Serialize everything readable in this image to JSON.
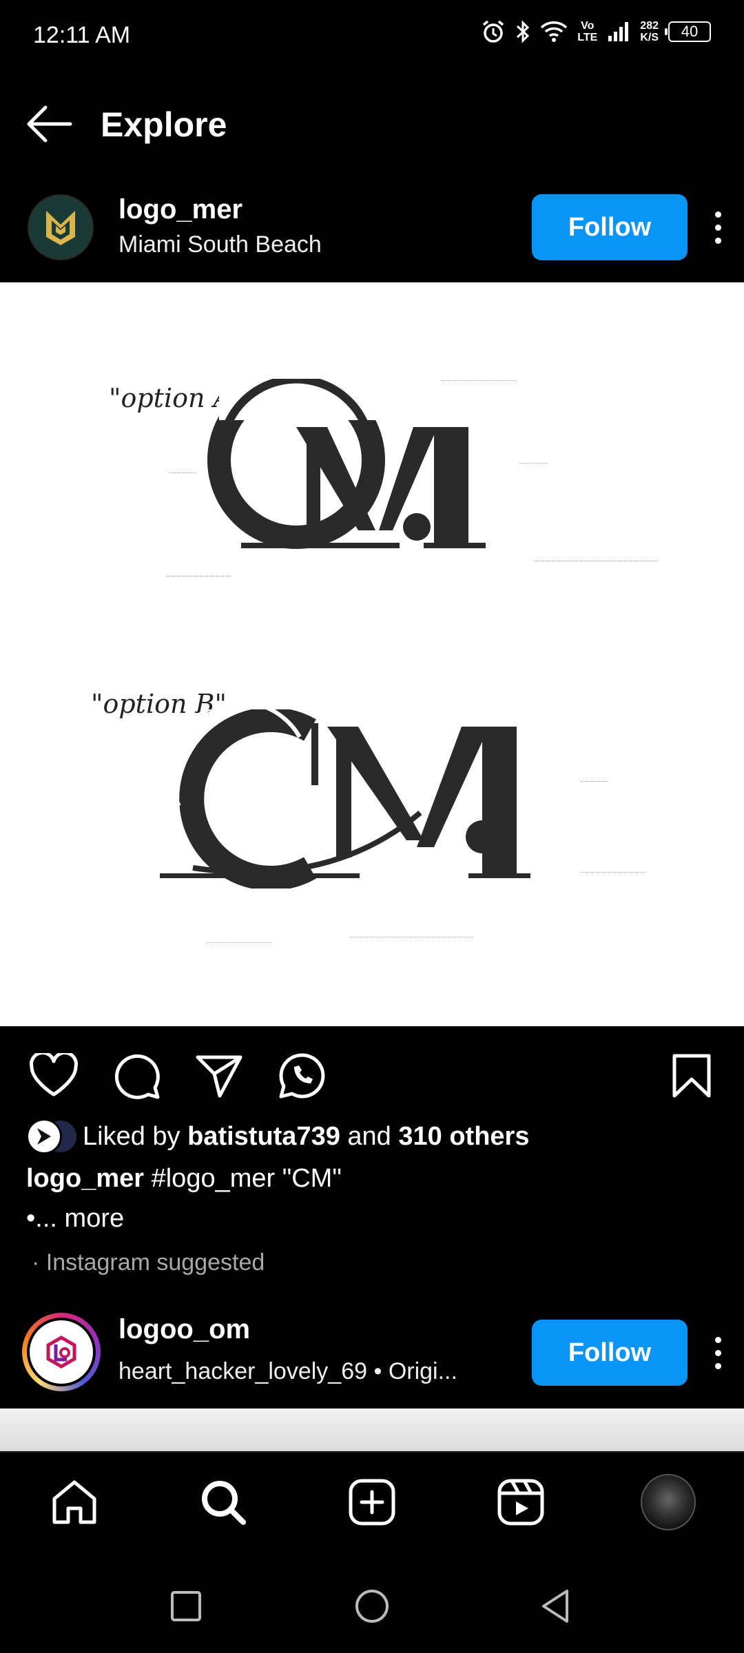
{
  "status_bar": {
    "time": "12:11 AM",
    "net_top": "Vo",
    "net_bottom": "LTE",
    "speed_value": "282",
    "speed_unit": "K/S",
    "battery": "40"
  },
  "header": {
    "title": "Explore"
  },
  "post": {
    "username": "logo_mer",
    "location": "Miami South Beach",
    "follow_label": "Follow",
    "image": {
      "option_a_label": "\"option A\"",
      "option_b_label": "\"option B\"",
      "monogram_letters": "CM"
    },
    "likes": {
      "prefix": "Liked by ",
      "liker": "batistuta739",
      "middle": " and ",
      "others": "310 others"
    },
    "caption": {
      "username": "logo_mer",
      "hashtag": "#logo_mer",
      "text": " \"CM\"",
      "more": "•... more"
    },
    "suggested_label": "· Instagram suggested"
  },
  "next_post": {
    "username": "logoo_om",
    "subtitle": "heart_hacker_lovely_69  •  Origi...",
    "follow_label": "Follow"
  },
  "icons": {
    "back": "arrow-left-icon",
    "like": "heart-icon",
    "comment": "comment-icon",
    "share": "send-icon",
    "whatsapp": "whatsapp-icon",
    "save": "bookmark-icon"
  },
  "colors": {
    "accent": "#0a95f6",
    "background": "#000000",
    "avatar_bg": "#1c3a35",
    "avatar_logo": "#d9b64a"
  }
}
